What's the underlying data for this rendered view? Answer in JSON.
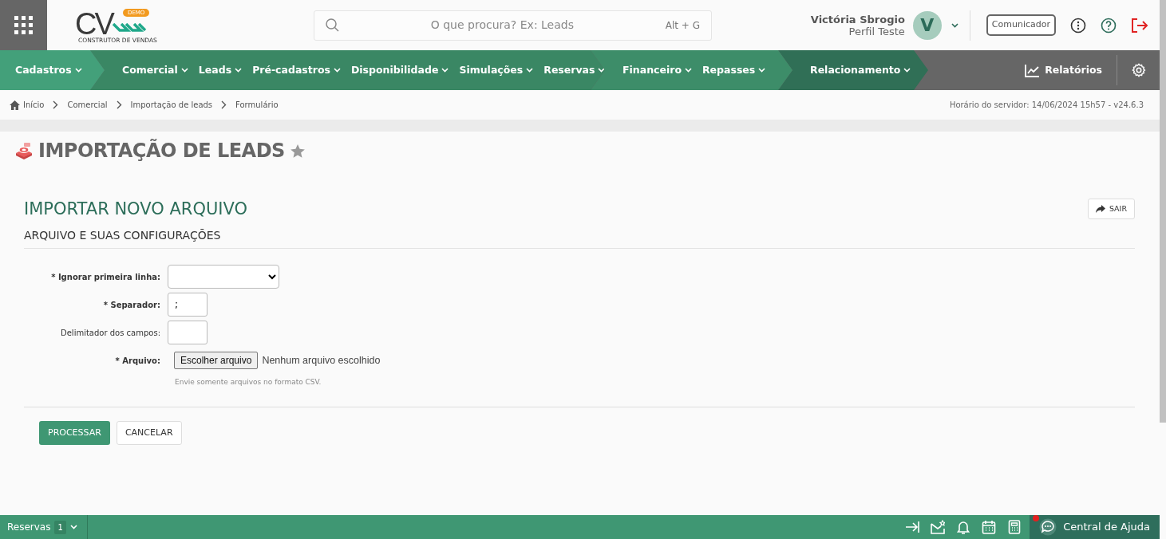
{
  "header": {
    "logo": {
      "letters": "CV",
      "badge": "DEMO",
      "tagline": "CONSTRUTOR DE VENDAS"
    },
    "search": {
      "placeholder": "O que procura? Ex: Leads",
      "shortcut": "Alt + G"
    },
    "user": {
      "name": "Victória Sbrogio",
      "profile": "Perfil Teste",
      "initial": "V"
    },
    "communicator_button": "Comunicador"
  },
  "nav": {
    "groups": [
      {
        "color": "#43a07a",
        "items": [
          "Cadastros"
        ]
      },
      {
        "color": "#3a8764",
        "items": [
          "Comercial",
          "Leads",
          "Pré-cadastros",
          "Disponibilidade",
          "Simulações",
          "Reservas"
        ]
      },
      {
        "color": "#3d8d69",
        "items": [
          "Financeiro",
          "Repasses"
        ]
      },
      {
        "color": "#306f56",
        "items": [
          "Relacionamento"
        ]
      }
    ],
    "reports": "Relatórios"
  },
  "breadcrumb": [
    "Início",
    "Comercial",
    "Importação de leads",
    "Formulário"
  ],
  "server_time": "Horário do servidor: 14/06/2024 15h57 - v24.6.3",
  "page_title": "IMPORTAÇÃO DE LEADS",
  "form": {
    "title": "IMPORTAR NOVO ARQUIVO",
    "exit_button": "SAIR",
    "section": "ARQUIVO E SUAS CONFIGURAÇÕES",
    "fields": [
      {
        "kind": "select",
        "label": "* Ignorar primeira linha:",
        "required": true
      },
      {
        "kind": "text",
        "label": "* Separador:",
        "required": true,
        "value": ";"
      },
      {
        "kind": "text",
        "label": "Delimitador dos campos:",
        "required": false
      },
      {
        "kind": "file",
        "label": "* Arquivo:",
        "required": true,
        "button": "Escolher arquivo",
        "status": "Nenhum arquivo escolhido",
        "help": "Envie somente arquivos no formato CSV."
      }
    ],
    "submit": "PROCESSAR",
    "cancel": "CANCELAR"
  },
  "footer": {
    "reservations": "Reservas",
    "count": "1",
    "help": "Central de Ajuda"
  }
}
